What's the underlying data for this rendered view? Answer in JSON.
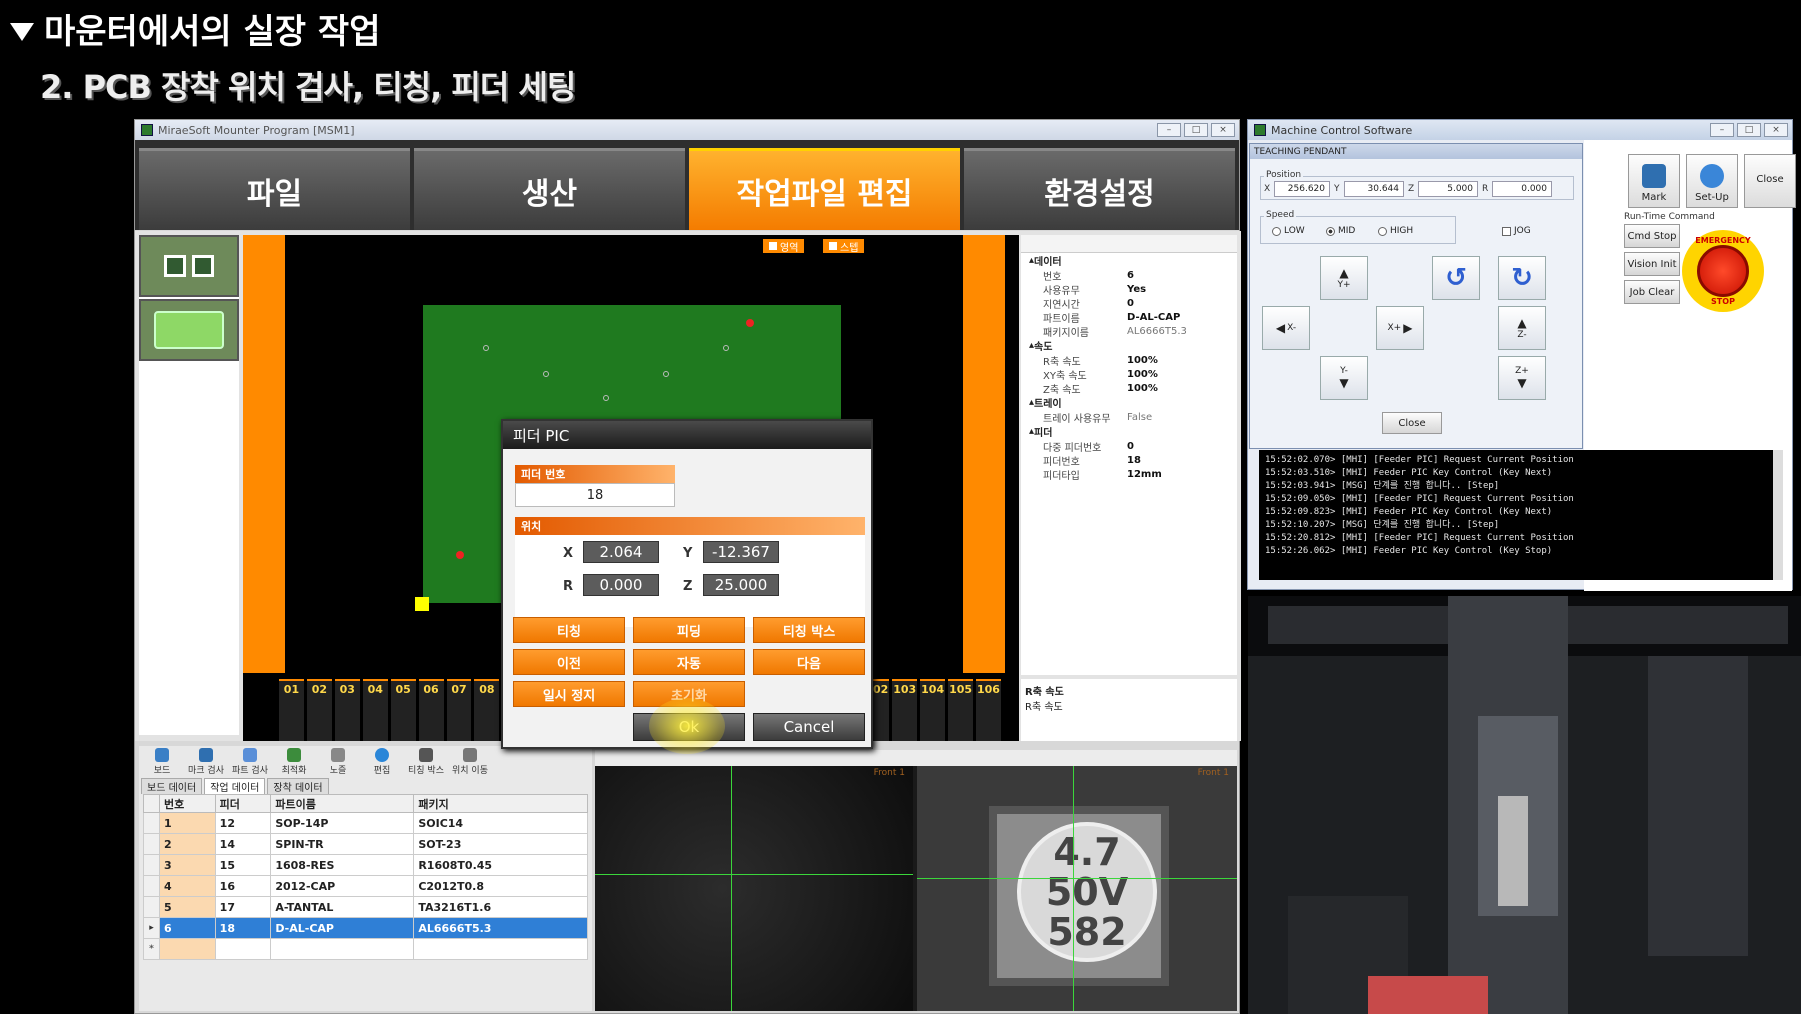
{
  "slide": {
    "title": "마운터에서의 실장 작업",
    "subtitle": "2. PCB 장착 위치 검사, 티칭, 피더 세팅"
  },
  "mounter": {
    "window_title": "MiraeSoft Mounter Program [MSM1]",
    "tabs": [
      {
        "label": "파일"
      },
      {
        "label": "생산"
      },
      {
        "label": "작업파일 편집"
      },
      {
        "label": "환경설정"
      }
    ],
    "legend": {
      "a": "영역",
      "b": "스텝"
    },
    "feeders_left": [
      "01",
      "02",
      "03",
      "04",
      "05",
      "06",
      "07",
      "08"
    ],
    "feeders_right": [
      "102",
      "103",
      "104",
      "105",
      "106"
    ],
    "props": {
      "sec_data": "데이터",
      "rows_data": [
        {
          "k": "번호",
          "v": "6"
        },
        {
          "k": "사용유무",
          "v": "Yes"
        },
        {
          "k": "지연시간",
          "v": "0"
        },
        {
          "k": "파트이름",
          "v": "D-AL-CAP"
        },
        {
          "k": "패키지이름",
          "v": "AL6666T5.3"
        }
      ],
      "sec_speed": "속도",
      "rows_speed": [
        {
          "k": "R축 속도",
          "v": "100%"
        },
        {
          "k": "XY축 속도",
          "v": "100%"
        },
        {
          "k": "Z축 속도",
          "v": "100%"
        }
      ],
      "sec_tray": "트레이",
      "rows_tray": [
        {
          "k": "트레이 사용유무",
          "v": "False"
        }
      ],
      "sec_feeder": "피더",
      "rows_feeder": [
        {
          "k": "다중 피더번호",
          "v": "0"
        },
        {
          "k": "피더번호",
          "v": "18"
        },
        {
          "k": "피더타입",
          "v": "12mm"
        }
      ],
      "bottom": [
        "R축 속도",
        "R축 속도"
      ]
    },
    "toolbar": [
      "보드",
      "마크 검사",
      "파트 검사",
      "최적화",
      "노즐",
      "편집",
      "티칭 박스",
      "위치 이동"
    ],
    "subtabs": [
      "보드 데이터",
      "작업 데이터",
      "장착 데이터"
    ],
    "table": {
      "headers": [
        "번호",
        "피더",
        "파트이름",
        "패키지"
      ],
      "rows": [
        {
          "no": "1",
          "feeder": "12",
          "part": "SOP-14P",
          "pkg": "SOIC14"
        },
        {
          "no": "2",
          "feeder": "14",
          "part": "SPIN-TR",
          "pkg": "SOT-23"
        },
        {
          "no": "3",
          "feeder": "15",
          "part": "1608-RES",
          "pkg": "R1608T0.45"
        },
        {
          "no": "4",
          "feeder": "16",
          "part": "2012-CAP",
          "pkg": "C2012T0.8"
        },
        {
          "no": "5",
          "feeder": "17",
          "part": "A-TANTAL",
          "pkg": "TA3216T1.6"
        },
        {
          "no": "6",
          "feeder": "18",
          "part": "D-AL-CAP",
          "pkg": "AL6666T5.3"
        }
      ]
    },
    "cam_text": {
      "front1": "Front 1",
      "front2": "Front 1"
    },
    "chip_text": [
      "4.7",
      "50V",
      "582"
    ]
  },
  "dialog": {
    "title": "피더 PIC",
    "feeder_no_label": "피더 번호",
    "feeder_no": "18",
    "position_label": "위치",
    "x_label": "X",
    "x": "2.064",
    "y_label": "Y",
    "y": "-12.367",
    "r_label": "R",
    "r": "0.000",
    "z_label": "Z",
    "z": "25.000",
    "buttons": [
      "티칭",
      "피딩",
      "티칭 박스",
      "이전",
      "자동",
      "다음",
      "일시 정지",
      "초기화"
    ],
    "ok": "Ok",
    "cancel": "Cancel"
  },
  "mcs": {
    "window_title": "Machine Control Software",
    "pendant_title": "TEACHING PENDANT",
    "position_label": "Position",
    "x_label": "X",
    "x": "256.620",
    "y_label": "Y",
    "y": "30.644",
    "z_label": "Z",
    "z": "5.000",
    "r_label": "R",
    "r": "0.000",
    "speed_label": "Speed",
    "speed_options": [
      "LOW",
      "MID",
      "HIGH"
    ],
    "jog_label": "JOG",
    "jog": {
      "y_plus": "Y+",
      "y_minus": "Y-",
      "x_minus": "X-",
      "x_plus": "X+",
      "z_minus": "Z-",
      "z_plus": "Z+"
    },
    "close": "Close",
    "right_buttons": {
      "mark": "Mark",
      "setup": "Set-Up",
      "close": "Close"
    },
    "runtime_label": "Run-Time Command",
    "runtime": [
      "Cmd Stop",
      "Vision Init",
      "Job Clear"
    ],
    "estop_top": "EMERGENCY",
    "estop_bottom": "STOP",
    "log": [
      "15:52:02.070> [MHI] [Feeder PIC] Request Current Position",
      "15:52:03.510> [MHI] Feeder PIC Key Control (Key Next)",
      "15:52:03.941> [MSG] 단계를 진행 합니다.. [Step]",
      "15:52:09.050> [MHI] [Feeder PIC] Request Current Position",
      "15:52:09.823> [MHI] Feeder PIC Key Control (Key Next)",
      "15:52:10.207> [MSG] 단계를 진행 합니다.. [Step]",
      "15:52:20.812> [MHI] [Feeder PIC] Request Current Position",
      "15:52:26.062> [MHI] Feeder PIC Key Control (Key Stop)"
    ]
  }
}
